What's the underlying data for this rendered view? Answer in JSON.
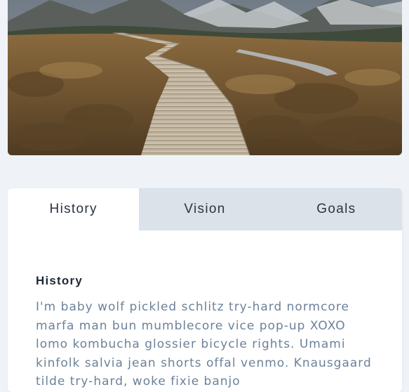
{
  "hero_image": {
    "icon": "mountain-boardwalk-photo"
  },
  "tabs": [
    {
      "label": "History",
      "active": true
    },
    {
      "label": "Vision",
      "active": false
    },
    {
      "label": "Goals",
      "active": false
    }
  ],
  "panel": {
    "title": "History",
    "body": "I'm baby wolf pickled schlitz try-hard normcore marfa man bun mumblecore vice pop-up XOXO lomo kombucha glossier bicycle rights. Umami kinfolk salvia jean shorts offal venmo. Knausgaard tilde try-hard, woke fixie banjo"
  },
  "colors": {
    "page_background": "#eff3f7",
    "tab_inactive": "#dbe2ea",
    "tab_active": "#ffffff",
    "body_text": "#6b8299",
    "heading_text": "#202a36"
  }
}
